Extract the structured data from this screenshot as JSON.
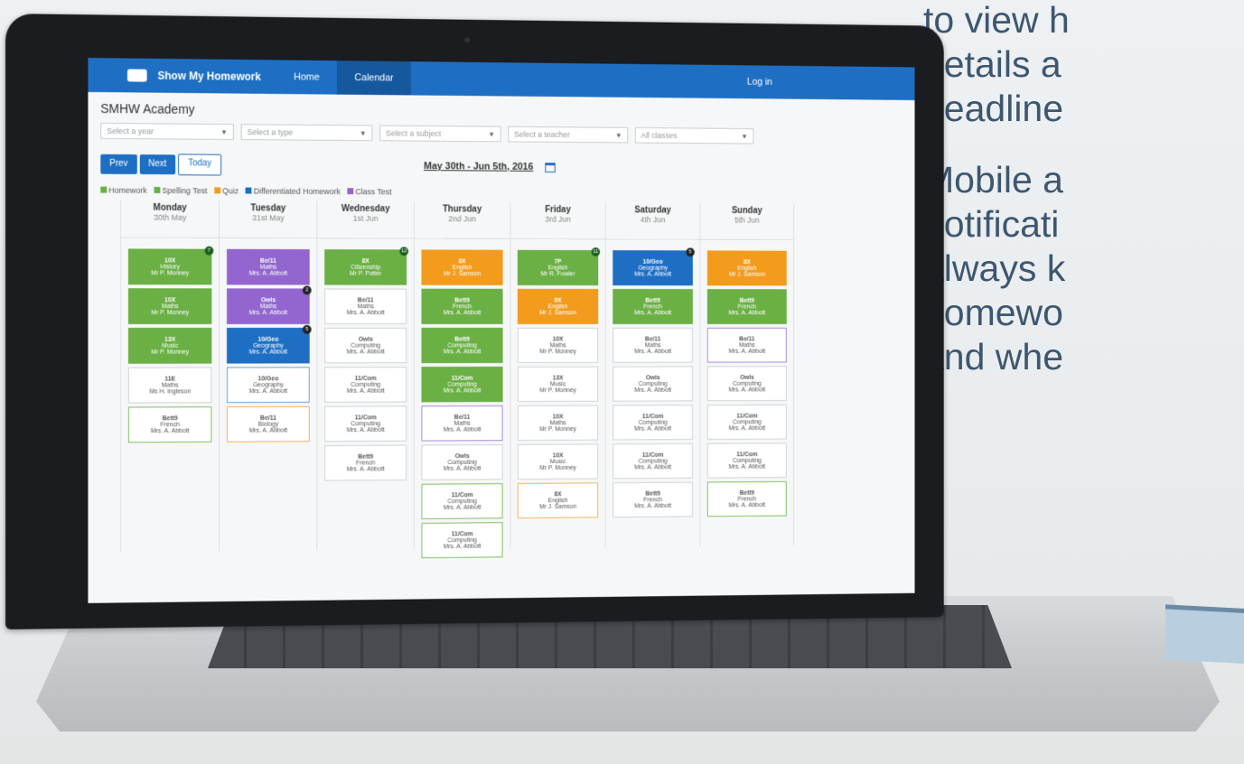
{
  "side_text": {
    "lines_top": [
      "to view h",
      "details a",
      "deadline"
    ],
    "lines_bottom": [
      "Mobile a",
      "notificati",
      "always k",
      "homewo",
      "and whe"
    ]
  },
  "app": {
    "brand": "Show My Homework",
    "nav": [
      "Home",
      "Calendar"
    ],
    "login": "Log in",
    "school": "SMHW Academy",
    "filters": [
      "Select a year",
      "Select a type",
      "Select a subject",
      "Select a teacher",
      "All classes"
    ],
    "buttons": {
      "prev": "Prev",
      "next": "Next",
      "today": "Today"
    },
    "date_range": "May 30th - Jun 5th, 2016",
    "legend": [
      {
        "label": "Homework",
        "color": "#6ab045"
      },
      {
        "label": "Spelling Test",
        "color": "#6ab045"
      },
      {
        "label": "Quiz",
        "color": "#f29b1d"
      },
      {
        "label": "Differentiated Homework",
        "color": "#1e6fc4"
      },
      {
        "label": "Class Test",
        "color": "#9366cf"
      }
    ],
    "days": [
      {
        "name": "Monday",
        "date": "30th May"
      },
      {
        "name": "Tuesday",
        "date": "31st May"
      },
      {
        "name": "Wednesday",
        "date": "1st Jun"
      },
      {
        "name": "Thursday",
        "date": "2nd Jun"
      },
      {
        "name": "Friday",
        "date": "3rd Jun"
      },
      {
        "name": "Saturday",
        "date": "4th Jun"
      },
      {
        "name": "Sunday",
        "date": "5th Jun"
      }
    ],
    "cards": {
      "mon": [
        {
          "c": "10X",
          "s": "History",
          "t": "Mr P. Monney",
          "badge": "7"
        },
        {
          "c": "10X",
          "s": "Maths",
          "t": "Mr P. Monney"
        },
        {
          "c": "13X",
          "s": "Music",
          "t": "Mr P. Monney"
        },
        {
          "c": "11E",
          "s": "Maths",
          "t": "Ms H. Ingleson"
        },
        {
          "c": "Bett9",
          "s": "French",
          "t": "Mrs. A. Abbott"
        }
      ],
      "tue": [
        {
          "c": "Be/11",
          "s": "Maths",
          "t": "Mrs. A. Abbott"
        },
        {
          "c": "Owls",
          "s": "Maths",
          "t": "Mrs. A. Abbott",
          "badge": "2"
        },
        {
          "c": "10/Geo",
          "s": "Geography",
          "t": "Mrs. A. Abbott",
          "badge": "5"
        },
        {
          "c": "10/Geo",
          "s": "Geography",
          "t": "Mrs. A. Abbott"
        },
        {
          "c": "Be/11",
          "s": "Biology",
          "t": "Mrs. A. Abbott"
        }
      ],
      "wed": [
        {
          "c": "8X",
          "s": "Citizenship",
          "t": "Mr P. Potter",
          "badge": "12"
        },
        {
          "c": "Be/11",
          "s": "Maths",
          "t": "Mrs. A. Abbott"
        },
        {
          "c": "Owls",
          "s": "Computing",
          "t": "Mrs. A. Abbott"
        },
        {
          "c": "11/Com",
          "s": "Computing",
          "t": "Mrs. A. Abbott"
        },
        {
          "c": "11/Com",
          "s": "Computing",
          "t": "Mrs. A. Abbott"
        },
        {
          "c": "Bett9",
          "s": "French",
          "t": "Mrs. A. Abbott"
        }
      ],
      "thu": [
        {
          "c": "8X",
          "s": "English",
          "t": "Mr J. Samson"
        },
        {
          "c": "Bett9",
          "s": "French",
          "t": "Mrs. A. Abbott"
        },
        {
          "c": "Bett9",
          "s": "Computing",
          "t": "Mrs. A. Abbott"
        },
        {
          "c": "11/Com",
          "s": "Computing",
          "t": "Mrs. A. Abbott"
        },
        {
          "c": "Be/11",
          "s": "Maths",
          "t": "Mrs. A. Abbott"
        },
        {
          "c": "Owls",
          "s": "Computing",
          "t": "Mrs. A. Abbott"
        },
        {
          "c": "11/Com",
          "s": "Computing",
          "t": "Mrs. A. Abbott"
        },
        {
          "c": "11/Com",
          "s": "Computing",
          "t": "Mrs. A. Abbott"
        }
      ],
      "fri": [
        {
          "c": "7P",
          "s": "English",
          "t": "Mr R. Fowler",
          "badge": "11"
        },
        {
          "c": "8X",
          "s": "English",
          "t": "Mr J. Samson"
        },
        {
          "c": "10X",
          "s": "Maths",
          "t": "Mr P. Monney"
        },
        {
          "c": "13X",
          "s": "Music",
          "t": "Mr P. Monney"
        },
        {
          "c": "10X",
          "s": "Maths",
          "t": "Mr P. Monney"
        },
        {
          "c": "10X",
          "s": "Music",
          "t": "Mr P. Monney"
        },
        {
          "c": "8X",
          "s": "English",
          "t": "Mr J. Samson"
        }
      ],
      "sat": [
        {
          "c": "10/Geo",
          "s": "Geography",
          "t": "Mrs. A. Abbott",
          "badge": "5"
        },
        {
          "c": "Bett9",
          "s": "French",
          "t": "Mrs. A. Abbott"
        },
        {
          "c": "Be/11",
          "s": "Maths",
          "t": "Mrs. A. Abbott"
        },
        {
          "c": "Owls",
          "s": "Computing",
          "t": "Mrs. A. Abbott"
        },
        {
          "c": "11/Com",
          "s": "Computing",
          "t": "Mrs. A. Abbott"
        },
        {
          "c": "11/Com",
          "s": "Computing",
          "t": "Mrs. A. Abbott"
        },
        {
          "c": "Bett9",
          "s": "French",
          "t": "Mrs. A. Abbott"
        }
      ],
      "sun": [
        {
          "c": "8X",
          "s": "English",
          "t": "Mr J. Samson"
        },
        {
          "c": "Bett9",
          "s": "French",
          "t": "Mrs. A. Abbott"
        },
        {
          "c": "Be/11",
          "s": "Maths",
          "t": "Mrs. A. Abbott"
        },
        {
          "c": "Owls",
          "s": "Computing",
          "t": "Mrs. A. Abbott"
        },
        {
          "c": "11/Com",
          "s": "Computing",
          "t": "Mrs. A. Abbott"
        },
        {
          "c": "11/Com",
          "s": "Computing",
          "t": "Mrs. A. Abbott"
        },
        {
          "c": "Bett9",
          "s": "French",
          "t": "Mrs. A. Abbott"
        }
      ]
    }
  }
}
